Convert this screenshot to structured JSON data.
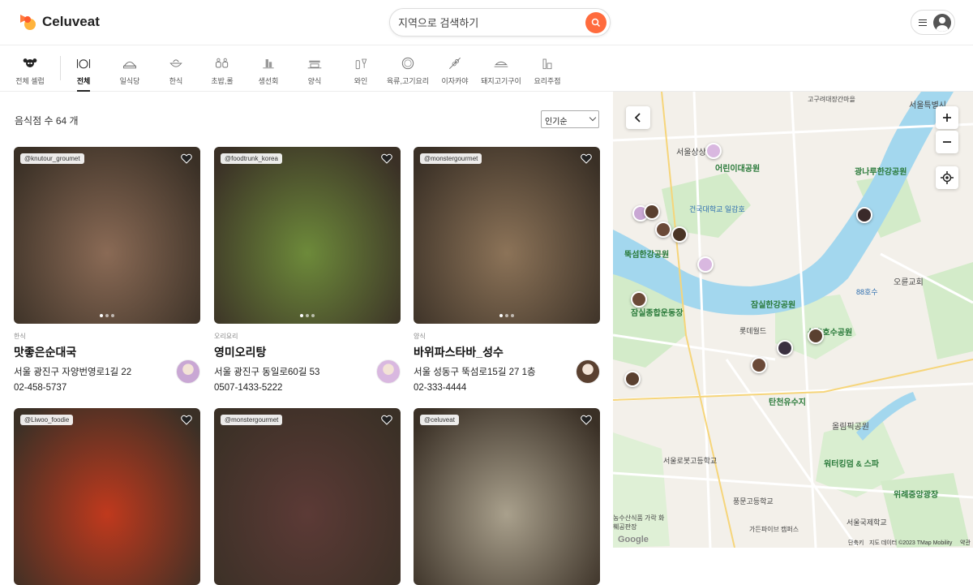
{
  "app": {
    "name": "Celuveat"
  },
  "search": {
    "placeholder": "지역으로 검색하기"
  },
  "categories": [
    {
      "label": "전체 셀럽",
      "icon": "celeb-icon"
    },
    {
      "label": "전체",
      "icon": "dish-icon",
      "active": true
    },
    {
      "label": "일식당",
      "icon": "sushi-icon"
    },
    {
      "label": "한식",
      "icon": "bowl-icon"
    },
    {
      "label": "초밥,롤",
      "icon": "sushi-roll-icon"
    },
    {
      "label": "생선회",
      "icon": "fish-icon"
    },
    {
      "label": "양식",
      "icon": "western-icon"
    },
    {
      "label": "와인",
      "icon": "wine-icon"
    },
    {
      "label": "육류,고기요리",
      "icon": "meat-icon"
    },
    {
      "label": "이자카야",
      "icon": "skewer-icon"
    },
    {
      "label": "돼지고기구이",
      "icon": "grill-icon"
    },
    {
      "label": "요리주점",
      "icon": "bar-icon"
    }
  ],
  "list": {
    "count_text": "음식점 수 64 개",
    "sort_value": "인기순"
  },
  "restaurants": [
    {
      "tag": "@knutour_groumet",
      "category": "한식",
      "name": "맛좋은순대국",
      "address": "서울 광진구 자양번영로1길 22",
      "phone": "02-458-5737",
      "photo": "#8a6a55",
      "celeb": "#c9a7d4"
    },
    {
      "tag": "@foodtrunk_korea",
      "category": "오리요리",
      "name": "영미오리탕",
      "address": "서울 광진구 동일로60길 53",
      "phone": "0507-1433-5222",
      "photo": "#6d8a3a",
      "celeb": "#d9b8e0"
    },
    {
      "tag": "@monstergourmet",
      "category": "양식",
      "name": "바위파스타바_성수",
      "address": "서울 성동구 뚝섬로15길 27 1층",
      "phone": "02-333-4444",
      "photo": "#8c7358",
      "celeb": "#5a4030"
    },
    {
      "tag": "@Liwoo_foodie",
      "category": "",
      "name": "",
      "address": "",
      "phone": "",
      "photo": "#c0391d",
      "celeb": ""
    },
    {
      "tag": "@monstergourmet",
      "category": "",
      "name": "",
      "address": "",
      "phone": "",
      "photo": "#5c3a36",
      "celeb": ""
    },
    {
      "tag": "@celuveat",
      "category": "",
      "name": "",
      "address": "",
      "phone": "",
      "photo": "#a9a08c",
      "celeb": ""
    }
  ],
  "map": {
    "labels": [
      {
        "text": "고구려대장간마을",
        "kind": "normal"
      },
      {
        "text": "서울특별시",
        "kind": "normal"
      },
      {
        "text": "서울상상",
        "kind": "normal"
      },
      {
        "text": "어린이대공원",
        "kind": "big"
      },
      {
        "text": "광나루한강공원",
        "kind": "big"
      },
      {
        "text": "건국대학교 일감호",
        "kind": "water"
      },
      {
        "text": "뚝섬한강공원",
        "kind": "big"
      },
      {
        "text": "오륜교회",
        "kind": "normal"
      },
      {
        "text": "88호수",
        "kind": "water"
      },
      {
        "text": "잠실한강공원",
        "kind": "big"
      },
      {
        "text": "잠실종합운동장",
        "kind": "big"
      },
      {
        "text": "롯데월드",
        "kind": "normal"
      },
      {
        "text": "석촌호수공원",
        "kind": "big"
      },
      {
        "text": "탄천유수지",
        "kind": "big"
      },
      {
        "text": "올림픽공원",
        "kind": "normal"
      },
      {
        "text": "서울로봇고등학교",
        "kind": "normal"
      },
      {
        "text": "워터킹덤 & 스파",
        "kind": "big"
      },
      {
        "text": "위례중앙광장",
        "kind": "big"
      },
      {
        "text": "풍문고등학교",
        "kind": "normal"
      },
      {
        "text": "농수산식품 가락 화훼공판장",
        "kind": "normal"
      },
      {
        "text": "서울국제학교",
        "kind": "normal"
      },
      {
        "text": "가든파이브 캠퍼스",
        "kind": "normal"
      }
    ],
    "footer": {
      "shortcuts": "단축키",
      "data": "지도 데이터 ©2023 TMap Mobility",
      "terms": "약관"
    },
    "google": "Google",
    "colors": {
      "water": "#9fd6ec",
      "park": "#c9e6c0",
      "road": "#ffffff",
      "land": "#f2efe9"
    }
  }
}
